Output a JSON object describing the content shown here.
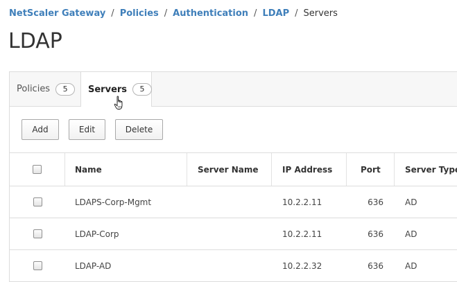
{
  "breadcrumb": {
    "items": [
      "NetScaler Gateway",
      "Policies",
      "Authentication",
      "LDAP"
    ],
    "current": "Servers",
    "separator": "/"
  },
  "page_title": "LDAP",
  "tabs": [
    {
      "label": "Policies",
      "count": "5"
    },
    {
      "label": "Servers",
      "count": "5"
    }
  ],
  "toolbar": {
    "add_label": "Add",
    "edit_label": "Edit",
    "delete_label": "Delete"
  },
  "table": {
    "columns": [
      "Name",
      "Server Name",
      "IP Address",
      "Port",
      "Server Type"
    ],
    "rows": [
      {
        "name": "LDAPS-Corp-Mgmt",
        "server_name": "",
        "ip": "10.2.2.11",
        "port": "636",
        "type": "AD"
      },
      {
        "name": "LDAP-Corp",
        "server_name": "",
        "ip": "10.2.2.11",
        "port": "636",
        "type": "AD"
      },
      {
        "name": "LDAP-AD",
        "server_name": "",
        "ip": "10.2.2.32",
        "port": "636",
        "type": "AD"
      }
    ]
  },
  "colors": {
    "link": "#3f7fba",
    "border": "#dcdcdc",
    "tabbar_bg": "#f7f7f7"
  },
  "icons": {
    "cursor": "hand-pointer-icon"
  }
}
